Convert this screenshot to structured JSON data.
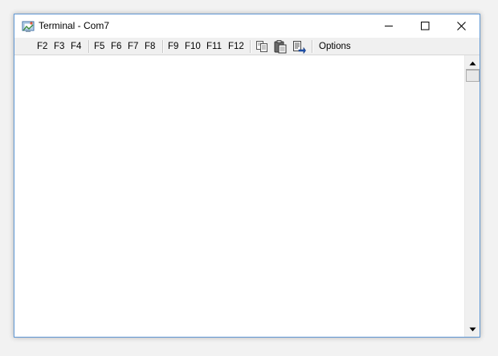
{
  "window": {
    "title": "Terminal - Com7"
  },
  "toolbar": {
    "group1": [
      "F2",
      "F3",
      "F4"
    ],
    "group2": [
      "F5",
      "F6",
      "F7",
      "F8"
    ],
    "group3": [
      "F9",
      "F10",
      "F11",
      "F12"
    ],
    "icons": [
      "copy-icon",
      "paste-icon",
      "paste-special-icon"
    ],
    "options_label": "Options"
  },
  "colors": {
    "window_border": "#5f97d4",
    "toolbar_bg": "#f0f0f0",
    "terminal_bg": "#ffffff"
  }
}
